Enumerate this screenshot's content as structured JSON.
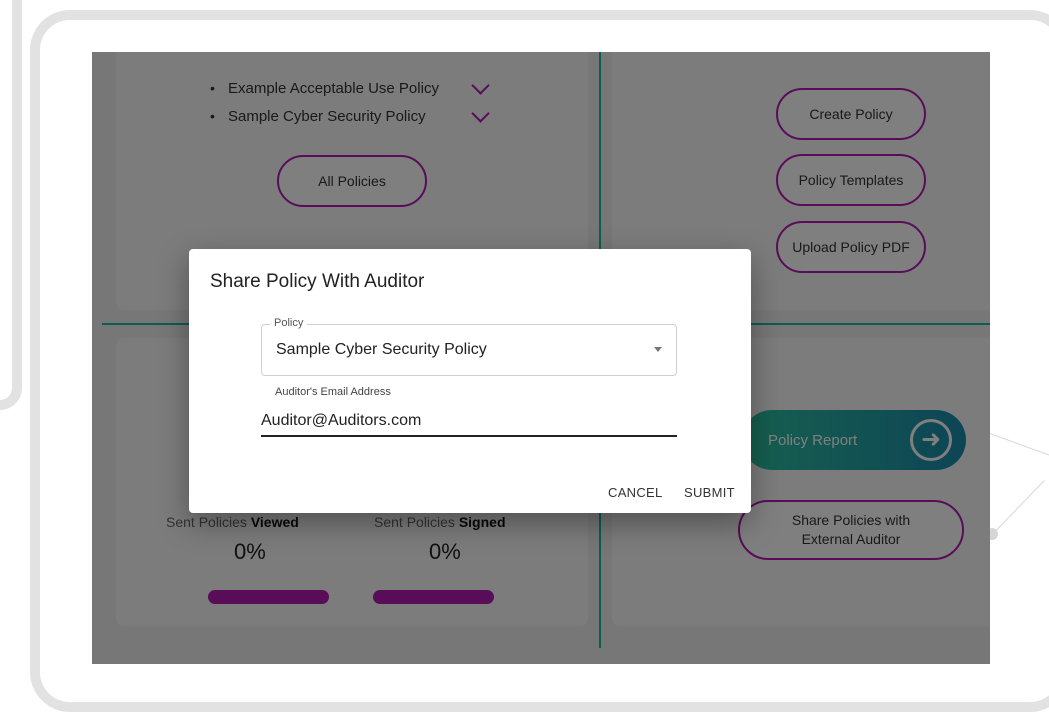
{
  "left_panel": {
    "policies": [
      {
        "label": "Example Acceptable Use Policy"
      },
      {
        "label": "Sample Cyber Security Policy"
      }
    ],
    "all_policies_label": "All Policies"
  },
  "right_panel": {
    "create_policy_label": "Create Policy",
    "policy_templates_label": "Policy Templates",
    "upload_policy_pdf_label": "Upload Policy PDF",
    "policy_report_label": "Policy Report",
    "share_policies_label_line1": "Share Policies with",
    "share_policies_label_line2": "External Auditor"
  },
  "stats": {
    "viewed_prefix": "Sent Policies ",
    "viewed_bold": "Viewed",
    "viewed_value": "0%",
    "signed_prefix": "Sent Policies ",
    "signed_bold": "Signed",
    "signed_value": "0%"
  },
  "dialog": {
    "title": "Share Policy With Auditor",
    "policy_field_label": "Policy",
    "policy_value": "Sample Cyber Security Policy",
    "email_label": "Auditor's Email Address",
    "email_value": "Auditor@Auditors.com",
    "cancel_label": "CANCEL",
    "submit_label": "SUBMIT"
  },
  "colors": {
    "accent": "#b31ab3",
    "divider": "#1abc9c",
    "report_gradient_start": "#2ec1a0",
    "report_gradient_end": "#1a8aab"
  },
  "icons": {
    "chevron": "chevron-down-icon",
    "report_arrow": "arrow-right-circle-icon",
    "select_caret": "caret-down-icon"
  }
}
